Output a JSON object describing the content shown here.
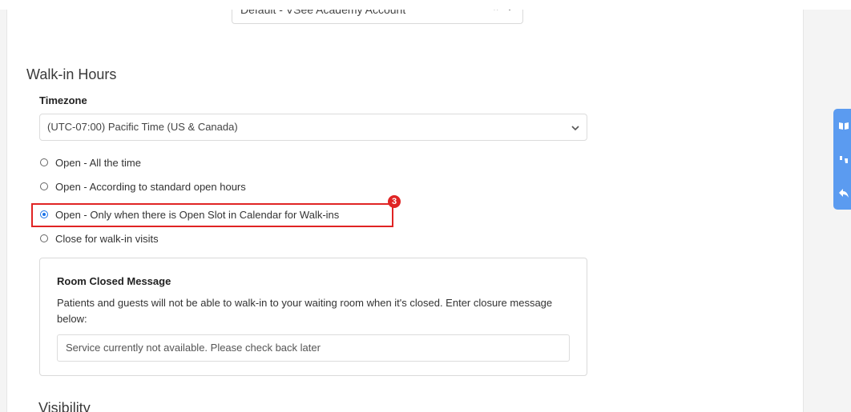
{
  "account": {
    "selected": "Default - VSee Academy Account",
    "clear_glyph": "×"
  },
  "walkin": {
    "title": "Walk-in Hours",
    "timezone_label": "Timezone",
    "timezone_value": "(UTC-07:00) Pacific Time (US & Canada)",
    "options": [
      {
        "label": "Open - All the time",
        "checked": false
      },
      {
        "label": "Open - According to standard open hours",
        "checked": false
      },
      {
        "label": "Open - Only when there is Open Slot in Calendar for Walk-ins",
        "checked": true
      },
      {
        "label": "Close for walk-in visits",
        "checked": false
      }
    ],
    "annotation_badge": "3"
  },
  "closed_message": {
    "title": "Room Closed Message",
    "description": "Patients and guests will not be able to walk-in to your waiting room when it's closed. Enter closure message below:",
    "input_value": "Service currently not available. Please check back later"
  },
  "visibility": {
    "title": "Visibility"
  },
  "side_widget": {
    "icons": [
      "book-icon",
      "thumbs-icon",
      "reply-icon"
    ]
  },
  "colors": {
    "accent": "#1a73e8",
    "highlight": "#e02424",
    "widget": "#5b9bf0"
  }
}
